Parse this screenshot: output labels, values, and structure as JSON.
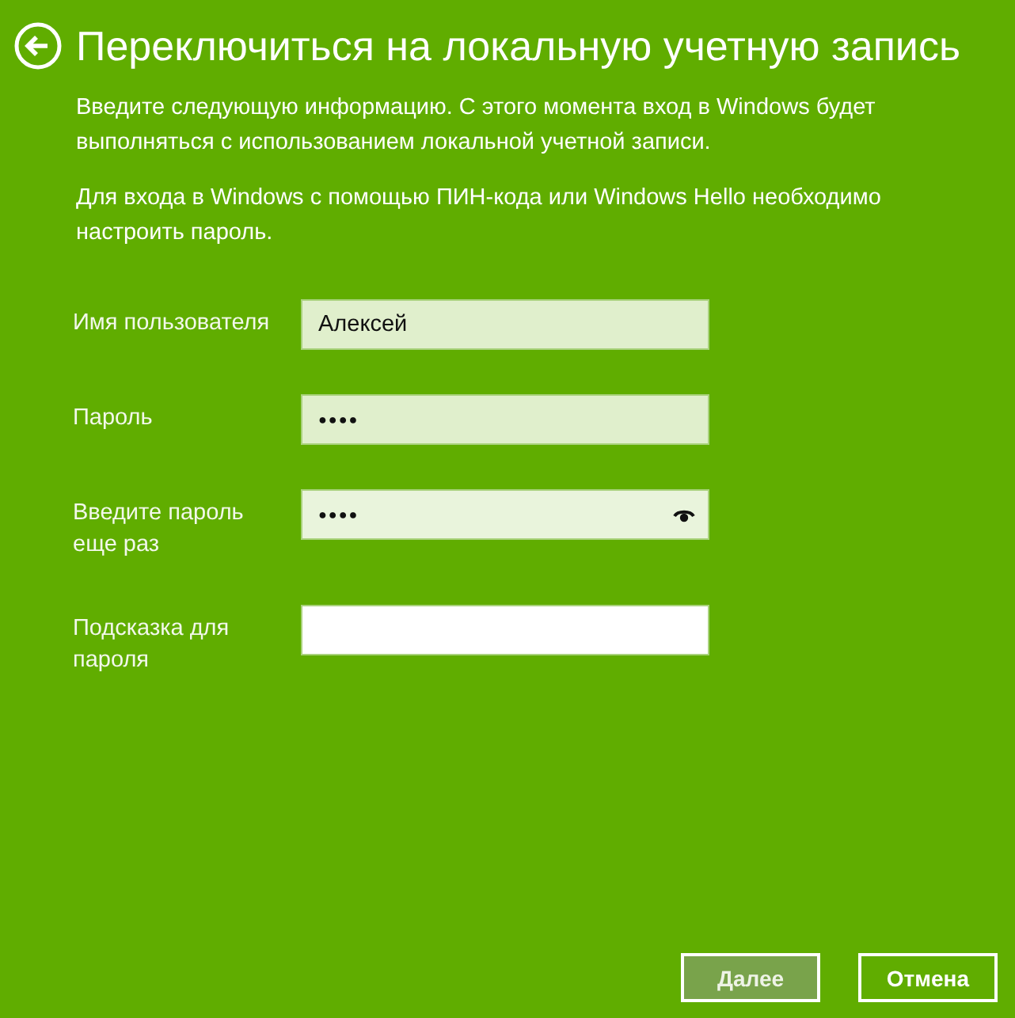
{
  "title": "Переключиться на локальную учетную запись",
  "paragraphs": [
    "Введите следующую информацию. С этого момента вход в Windows будет выполняться с использованием локальной учетной записи.",
    "Для входа в Windows с помощью ПИН-кода или Windows Hello необходимо настроить пароль."
  ],
  "fields": [
    {
      "label": "Имя пользователя",
      "kind": "text",
      "value": "Алексей",
      "focused": false,
      "hovered": false,
      "reveal": false
    },
    {
      "label": "Пароль",
      "kind": "password",
      "value": "●●●●",
      "focused": false,
      "hovered": false,
      "reveal": false
    },
    {
      "label": "Введите пароль еще раз",
      "kind": "password",
      "value": "●●●●",
      "focused": false,
      "hovered": true,
      "reveal": true
    },
    {
      "label": "Подсказка для пароля",
      "kind": "text",
      "focused": true,
      "hovered": false,
      "reveal": false
    }
  ],
  "buttons": [
    {
      "label": "Далее",
      "default": true
    },
    {
      "label": "Отмена",
      "default": false
    }
  ]
}
